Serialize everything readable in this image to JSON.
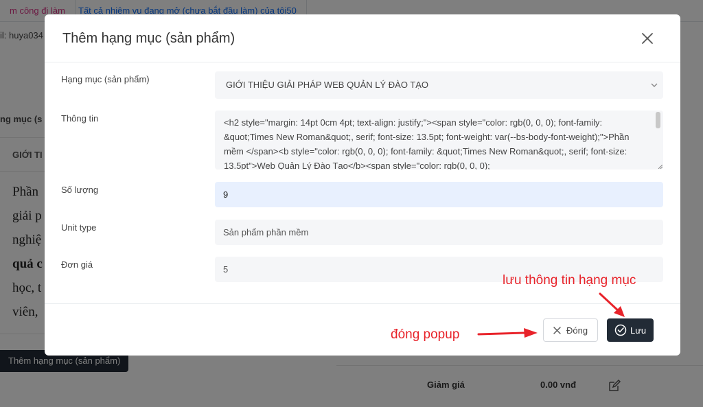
{
  "background": {
    "tabs": [
      "m công đi làm",
      "Tất cả nhiệm vụ đang mở (chưa bắt đầu làm) của tôi50"
    ],
    "user_text": "il: huya034",
    "category_label": "ng mục (s",
    "row_text": "GIỚI TI",
    "paragraph_lines": [
      "Phần",
      "giải p",
      "nghiệ",
      "quả c",
      "học, t",
      "viên,"
    ],
    "add_button": "Thêm hạng mục (sản phẩm)",
    "discount_label": "Giảm giá",
    "discount_value": "0.00 vnđ"
  },
  "modal": {
    "title": "Thêm hạng mục (sản phẩm)",
    "fields": {
      "category": {
        "label": "Hạng mục (sản phẩm)",
        "value": "GIỚI THIỆU GIẢI PHÁP WEB QUẢN LÝ ĐÀO TẠO"
      },
      "info": {
        "label": "Thông tin",
        "value": "<h2 style=\"margin: 14pt 0cm 4pt; text-align: justify;\"><span style=\"color: rgb(0, 0, 0); font-family: &quot;Times New Roman&quot;, serif; font-size: 13.5pt; font-weight: var(--bs-body-font-weight);\">Phần mềm </span><b style=\"color: rgb(0, 0, 0); font-family: &quot;Times New Roman&quot;, serif; font-size: 13.5pt\">Web Quản Lý Đào Tạo</b><span style=\"color: rgb(0, 0, 0);"
      },
      "quantity": {
        "label": "Số lượng",
        "value": "9"
      },
      "unit_type": {
        "label": "Unit type",
        "value": "Sản phẩm phần mềm"
      },
      "unit_price": {
        "label": "Đơn giá",
        "value": "5"
      }
    },
    "buttons": {
      "close": "Đóng",
      "save": "Lưu"
    }
  },
  "annotations": {
    "save_note": "lưu thông tin hạng mục",
    "close_note": "đóng popup"
  },
  "colors": {
    "accent_dark": "#222b36",
    "annotation_red": "#e8232a",
    "input_bg": "#f5f6f8",
    "autofill_bg": "#e8f0fe"
  }
}
